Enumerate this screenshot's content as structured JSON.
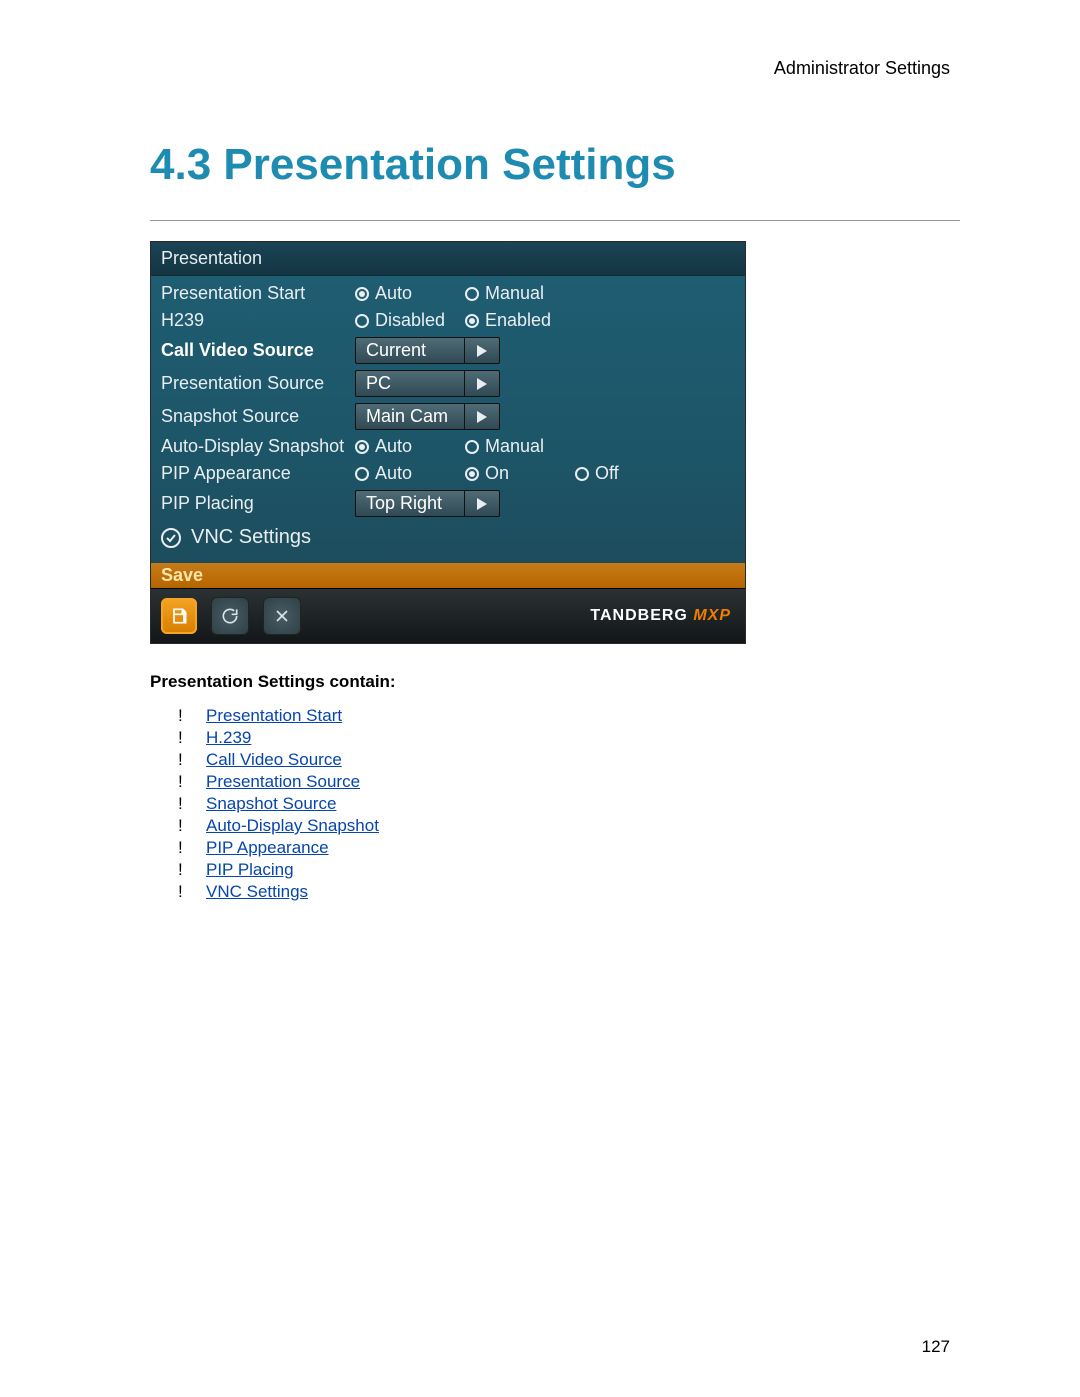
{
  "meta": {
    "header": "Administrator Settings",
    "heading": "4.3 Presentation Settings",
    "pageNumber": "127"
  },
  "device": {
    "title": "Presentation",
    "rows": {
      "presentationStart": {
        "label": "Presentation Start",
        "options": [
          "Auto",
          "Manual"
        ],
        "selected": "Auto"
      },
      "h239": {
        "label": "H239",
        "options": [
          "Disabled",
          "Enabled"
        ],
        "selected": "Enabled"
      },
      "callVideoSource": {
        "label": "Call Video Source",
        "value": "Current"
      },
      "presentationSource": {
        "label": "Presentation Source",
        "value": "PC"
      },
      "snapshotSource": {
        "label": "Snapshot Source",
        "value": "Main Cam"
      },
      "autoDisplaySnapshot": {
        "label": "Auto-Display Snapshot",
        "options": [
          "Auto",
          "Manual"
        ],
        "selected": "Auto"
      },
      "pipAppearance": {
        "label": "PIP Appearance",
        "options": [
          "Auto",
          "On",
          "Off"
        ],
        "selected": "On"
      },
      "pipPlacing": {
        "label": "PIP Placing",
        "value": "Top Right"
      },
      "vncSettings": {
        "label": "VNC Settings"
      }
    },
    "saveLabel": "Save",
    "brand": {
      "name": "TANDBERG",
      "suffix": "MXP"
    }
  },
  "post": {
    "containLabel": "Presentation Settings contain:",
    "links": [
      "Presentation Start",
      "H.239",
      "Call Video Source",
      "Presentation Source",
      "Snapshot Source",
      "Auto-Display Snapshot",
      "PIP Appearance",
      "PIP Placing",
      "VNC Settings"
    ]
  }
}
